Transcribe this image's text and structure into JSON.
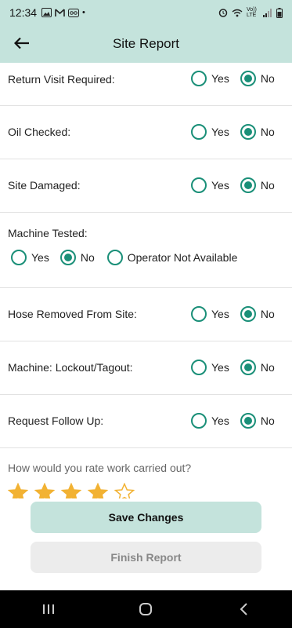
{
  "statusbar": {
    "time": "12:34",
    "dot": "•",
    "volte": "Vo)) LTE"
  },
  "appbar": {
    "title": "Site Report"
  },
  "questions": [
    {
      "label": "Return Visit Required:",
      "options": [
        "Yes",
        "No"
      ],
      "selected": "No"
    },
    {
      "label": "Oil Checked:",
      "options": [
        "Yes",
        "No"
      ],
      "selected": "No"
    },
    {
      "label": "Site Damaged:",
      "options": [
        "Yes",
        "No"
      ],
      "selected": "No"
    },
    {
      "label": "Machine Tested:",
      "options": [
        "Yes",
        "No",
        "Operator Not Available"
      ],
      "selected": "No"
    },
    {
      "label": "Hose Removed From Site:",
      "options": [
        "Yes",
        "No"
      ],
      "selected": "No"
    },
    {
      "label": "Machine: Lockout/Tagout:",
      "options": [
        "Yes",
        "No"
      ],
      "selected": "No"
    },
    {
      "label": "Request Follow Up:",
      "options": [
        "Yes",
        "No"
      ],
      "selected": "No"
    }
  ],
  "rating": {
    "label": "How would you rate work carried out?",
    "value": 4,
    "max": 5
  },
  "actions": {
    "save_label": "Save Changes",
    "finish_label": "Finish Report"
  },
  "colors": {
    "header_bg": "#c4e3dc",
    "radio": "#1a8f78",
    "star": "#f2b233"
  },
  "icons": [
    "back-arrow-icon",
    "recents-icon",
    "home-icon",
    "nav-back-icon"
  ]
}
